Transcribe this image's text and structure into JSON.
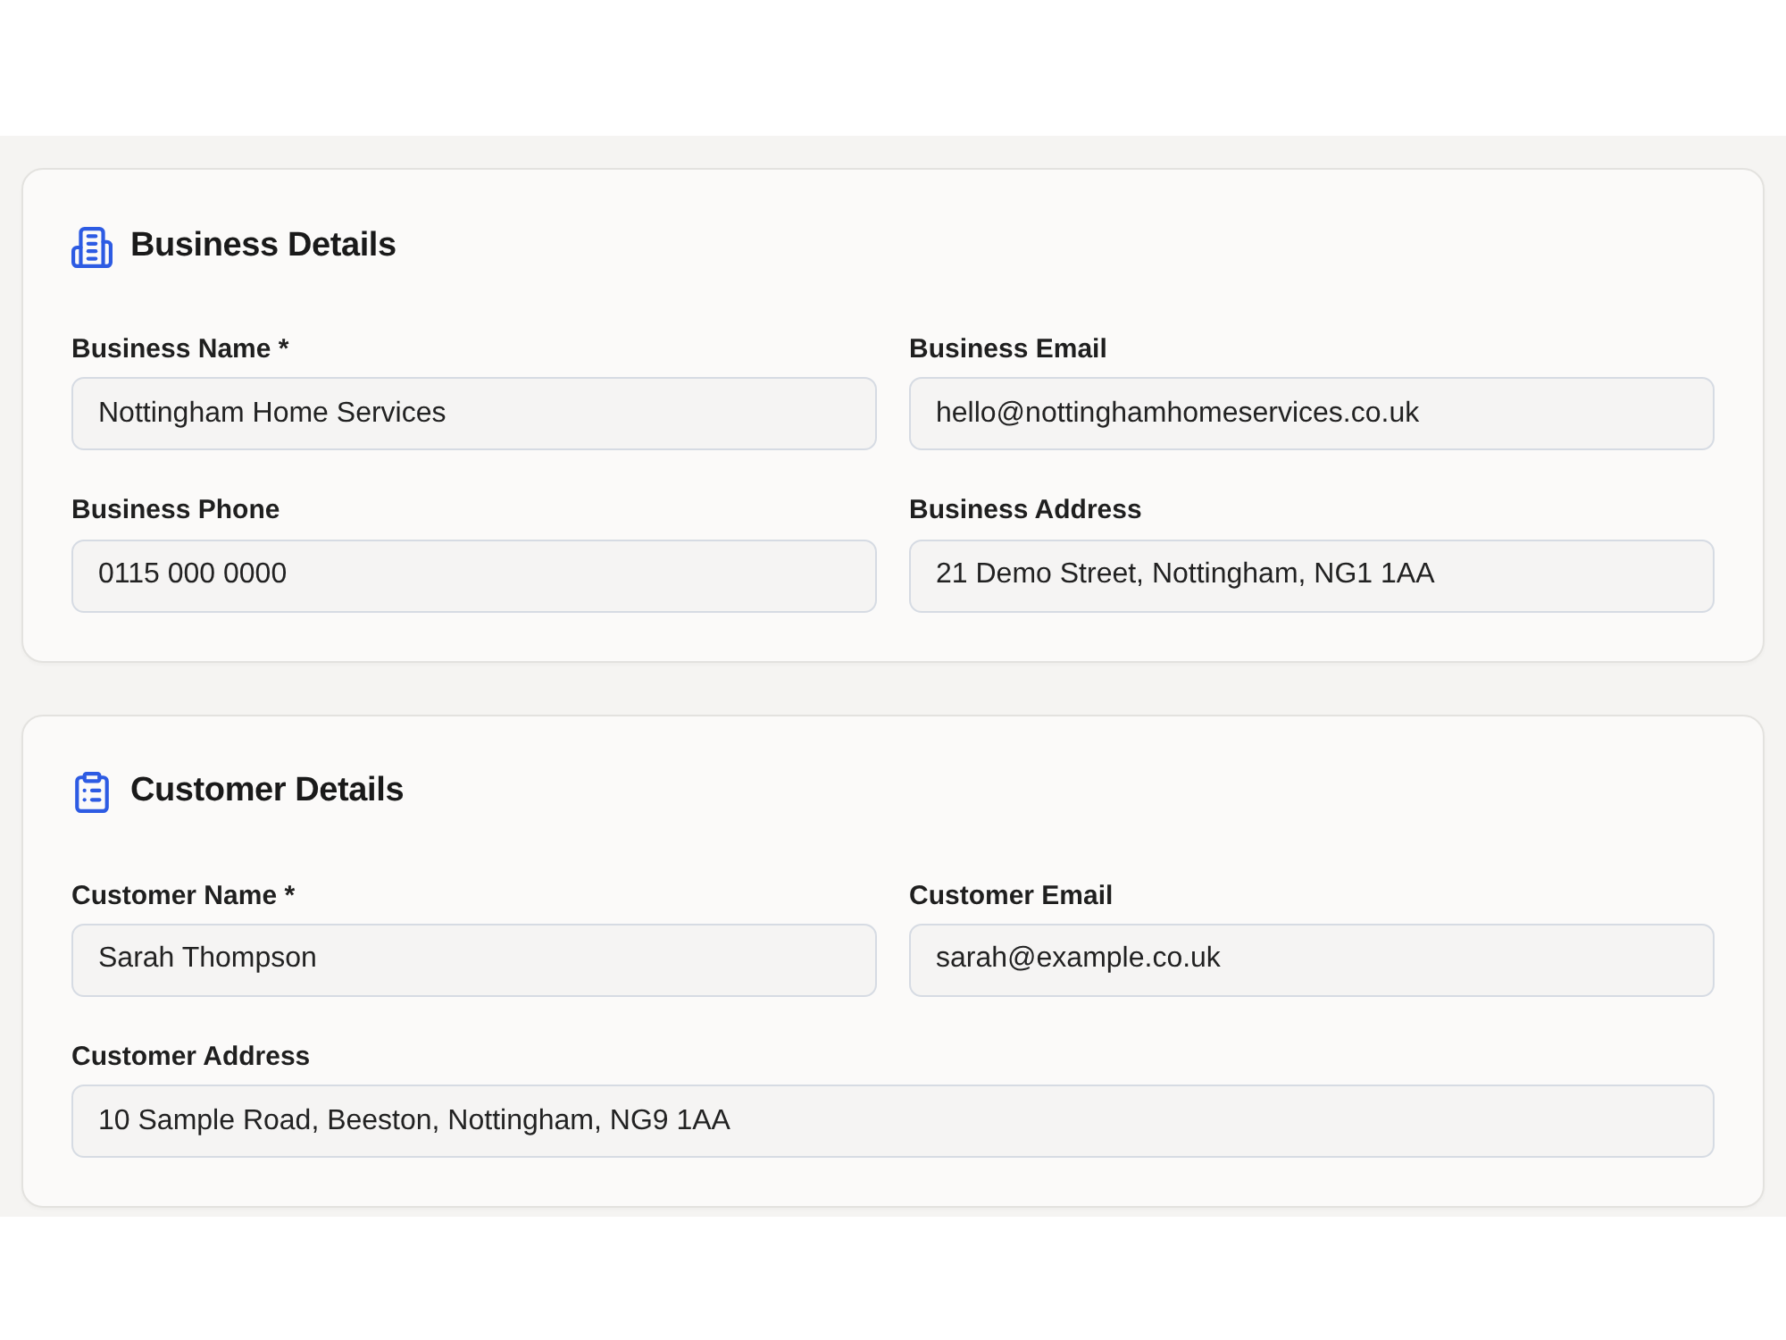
{
  "sections": [
    {
      "title": "Business Details",
      "rows": [
        [
          {
            "label": "Business Name *",
            "value": "Nottingham Home Services"
          },
          {
            "label": "Business Email",
            "value": "hello@nottinghamhomeservices.co.uk"
          }
        ],
        [
          {
            "label": "Business Phone",
            "value": "0115 000 0000"
          },
          {
            "label": "Business Address",
            "value": "21 Demo Street, Nottingham, NG1 1AA"
          }
        ]
      ]
    },
    {
      "title": "Customer Details",
      "rows": [
        [
          {
            "label": "Customer Name *",
            "value": "Sarah Thompson"
          },
          {
            "label": "Customer Email",
            "value": "sarah@example.co.uk"
          }
        ],
        [
          {
            "label": "Customer Address",
            "value": "10 Sample Road, Beeston, Nottingham, NG9 1AA"
          }
        ]
      ]
    }
  ]
}
